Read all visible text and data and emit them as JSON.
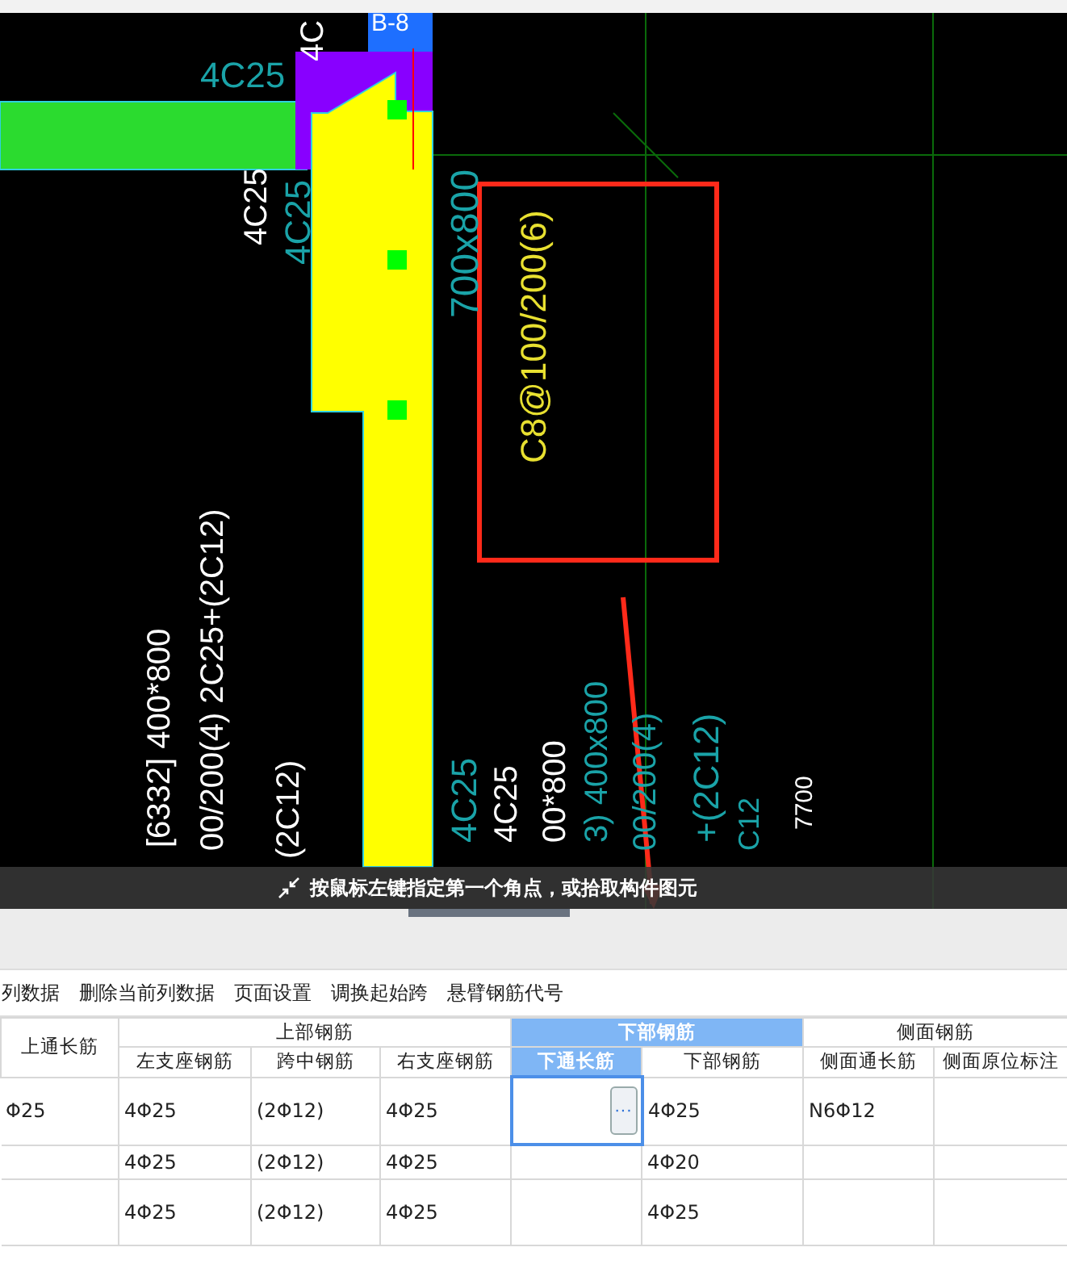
{
  "drawing": {
    "labels": [
      {
        "text": "4C",
        "kind": "white"
      },
      {
        "text": "B-8",
        "kind": "white"
      },
      {
        "text": "4C25",
        "kind": "teal"
      },
      {
        "text": "4C25",
        "kind": "white"
      },
      {
        "text": "4C25",
        "kind": "teal"
      },
      {
        "text": "700x800",
        "kind": "teal"
      },
      {
        "text": "C8@100/200(6)",
        "kind": "yellow"
      },
      {
        "text": "[6332] 400*800",
        "kind": "white"
      },
      {
        "text": "00/200(4) 2C25+(2C12)",
        "kind": "white"
      },
      {
        "text": "(2C12)",
        "kind": "white"
      },
      {
        "text": "4C25",
        "kind": "teal"
      },
      {
        "text": "4C25",
        "kind": "white"
      },
      {
        "text": "00*800",
        "kind": "white"
      },
      {
        "text": "3) 400x800",
        "kind": "teal"
      },
      {
        "text": "00/200(4)",
        "kind": "teal"
      },
      {
        "text": "+(2C12)",
        "kind": "teal"
      },
      {
        "text": "C12",
        "kind": "teal"
      },
      {
        "text": "7700",
        "kind": "white"
      }
    ],
    "status_prompt": "按鼠标左键指定第一个角点，或拾取构件图元"
  },
  "toolbar": [
    "列数据",
    "删除当前列数据",
    "页面设置",
    "调换起始跨",
    "悬臂钢筋代号"
  ],
  "table": {
    "header_groups": [
      {
        "label": "上通长筋",
        "selected": false
      },
      {
        "label": "上部钢筋",
        "selected": false,
        "columns": [
          {
            "label": "左支座钢筋",
            "selected": false
          },
          {
            "label": "跨中钢筋",
            "selected": false
          },
          {
            "label": "右支座钢筋",
            "selected": false
          }
        ]
      },
      {
        "label": "下部钢筋",
        "selected": true,
        "columns": [
          {
            "label": "下通长筋",
            "selected": true
          },
          {
            "label": "下部钢筋",
            "selected": false
          }
        ]
      },
      {
        "label": "侧面钢筋",
        "selected": false,
        "columns": [
          {
            "label": "侧面通长筋",
            "selected": false
          },
          {
            "label": "侧面原位标注",
            "selected": false
          }
        ]
      }
    ],
    "rows": [
      {
        "selected": true,
        "cells": [
          "Φ25",
          "4Φ25",
          "(2Φ12)",
          "4Φ25",
          null,
          "4Φ25",
          "N6Φ12",
          null
        ]
      },
      {
        "selected": false,
        "cells": [
          null,
          "4Φ25",
          "(2Φ12)",
          "4Φ25",
          null,
          "4Φ20",
          null,
          null
        ]
      },
      {
        "selected": false,
        "cells": [
          null,
          "4Φ25",
          "(2Φ12)",
          "4Φ25",
          null,
          "4Φ25",
          null,
          null
        ]
      }
    ],
    "edit_button": "···"
  }
}
